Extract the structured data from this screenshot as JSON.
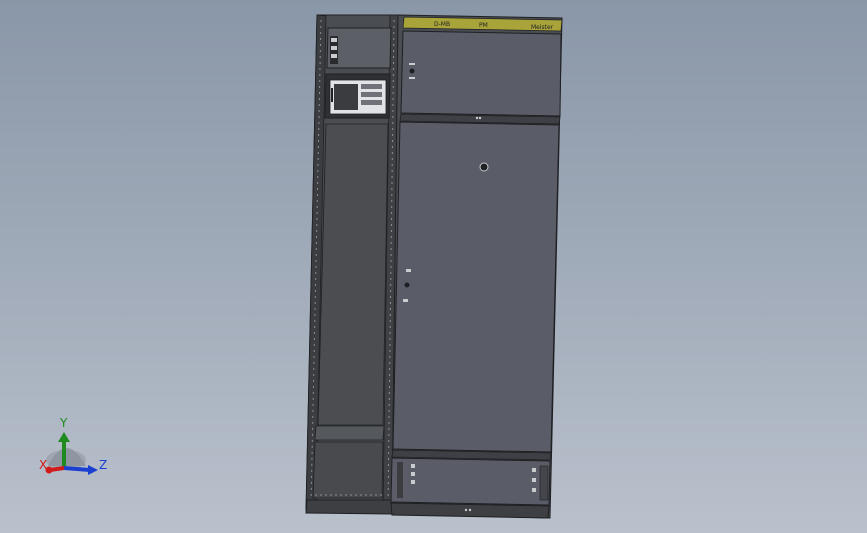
{
  "viewport": {
    "background_top": "#8a97a8",
    "background_bottom": "#b9c1cc"
  },
  "model": {
    "description_icon": "electrical-cabinet-model",
    "nameplate": {
      "label_1": "D-MB",
      "label_2": "PM",
      "label_3": "Meister"
    },
    "colors": {
      "frame": "#4a4d52",
      "door": "#5a5d68",
      "interior": "#4b4d50",
      "nameplate": "#a8a43a",
      "edge": "#1f2023"
    }
  },
  "triad": {
    "x_label": "X",
    "y_label": "Y",
    "z_label": "Z",
    "x_color": "#d11a1a",
    "y_color": "#1f8a1f",
    "z_color": "#1a3fd1"
  }
}
